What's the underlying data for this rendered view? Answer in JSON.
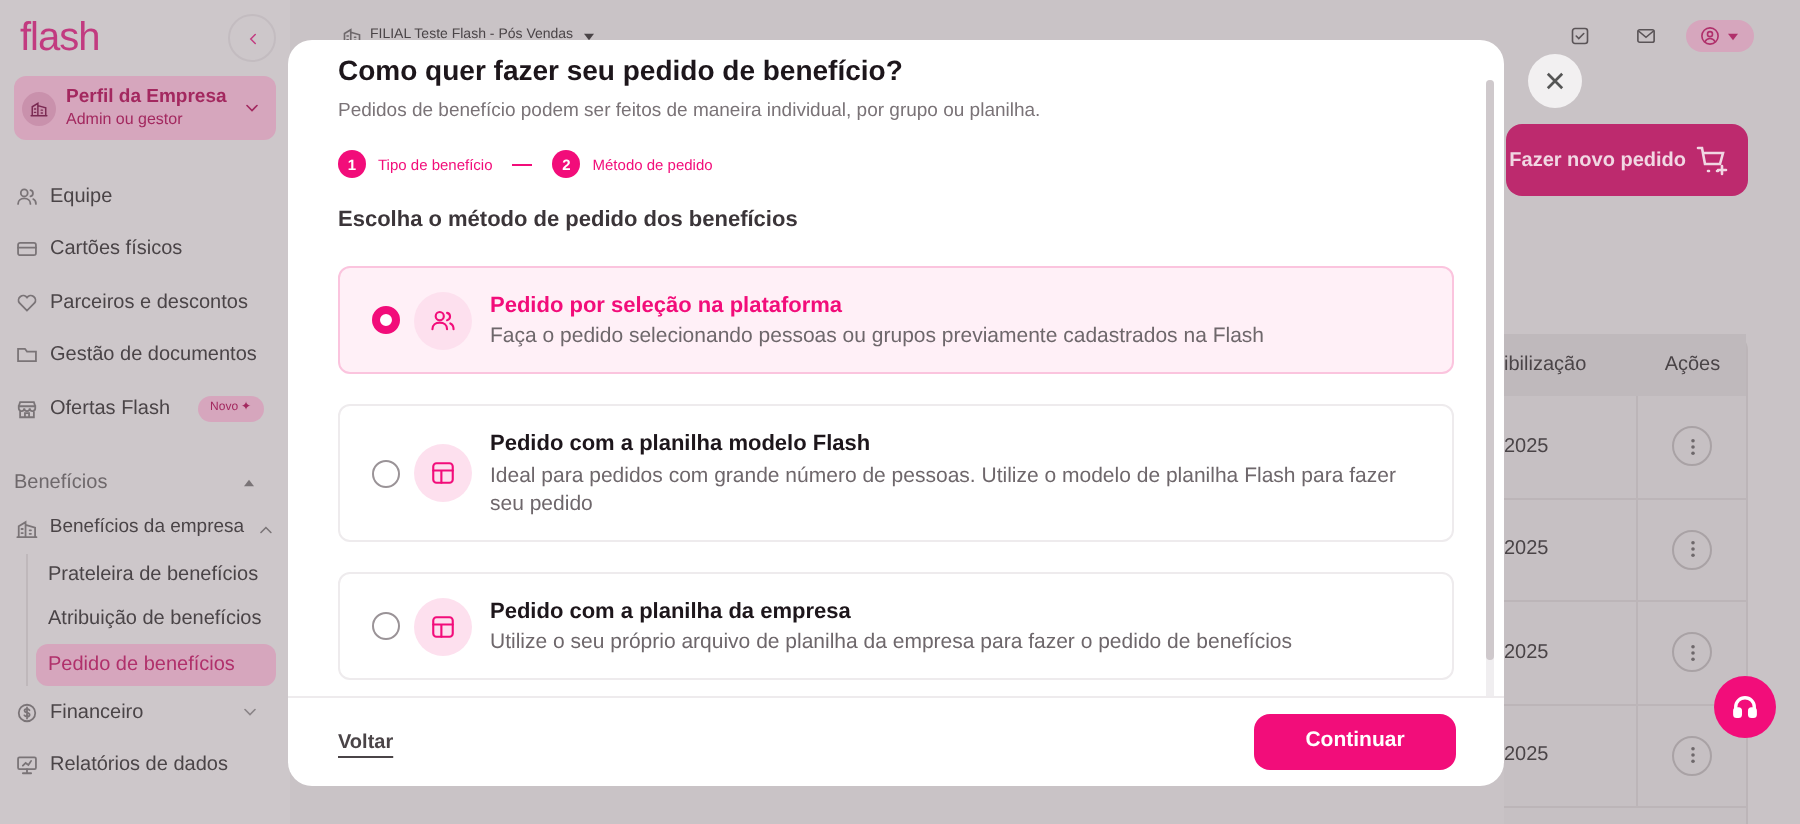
{
  "sidebar": {
    "logo": "flash",
    "profile": {
      "title": "Perfil da Empresa",
      "subtitle": "Admin ou gestor",
      "expanded": false
    },
    "items": [
      {
        "kind": "team",
        "label": "Equipe"
      },
      {
        "kind": "card",
        "label": "Cartões físicos"
      },
      {
        "kind": "partner",
        "label": "Parceiros e descontos"
      },
      {
        "kind": "folder",
        "label": "Gestão de documentos"
      },
      {
        "kind": "store",
        "label": "Ofertas Flash",
        "badge": "Novo ✦"
      }
    ],
    "section": {
      "label": "Benefícios",
      "expanded": true
    },
    "group": {
      "label": "Benefícios da empresa",
      "expanded": true,
      "children": [
        {
          "label": "Prateleira de benefícios",
          "selected": false
        },
        {
          "label": "Atribuição de benefícios",
          "selected": false
        },
        {
          "label": "Pedido de benefícios",
          "selected": true
        }
      ]
    },
    "more": [
      {
        "kind": "money",
        "label": "Financeiro",
        "expanded": false
      },
      {
        "kind": "report",
        "label": "Relatórios de dados"
      }
    ]
  },
  "topbar": {
    "company": "FILIAL Teste Flash - Pós Vendas"
  },
  "page": {
    "new_order_button": "Fazer novo pedido",
    "table": {
      "columns": [
        "ibilização",
        "Ações"
      ],
      "rows": [
        {
          "column_1": "2025"
        },
        {
          "column_1": "2025"
        },
        {
          "column_1": "2025"
        },
        {
          "column_1": "2025"
        }
      ]
    }
  },
  "modal": {
    "title": "Como quer fazer seu pedido de benefício?",
    "subtitle": "Pedidos de benefício podem ser feitos de maneira individual, por grupo ou planilha.",
    "steps": [
      {
        "number": "1",
        "label": "Tipo de benefício"
      },
      {
        "number": "2",
        "label": "Método de pedido"
      }
    ],
    "prompt": "Escolha o método de pedido dos benefícios",
    "options": [
      {
        "kind": "platform",
        "title": "Pedido por seleção na plataforma",
        "description": "Faça o pedido selecionando pessoas ou grupos previamente cadastrados na Flash",
        "selected": true
      },
      {
        "kind": "spreadsheet",
        "title": "Pedido com a planilha modelo Flash",
        "description": "Ideal para pedidos com grande número de pessoas. Utilize o modelo de planilha Flash para fazer seu pedido",
        "selected": false
      },
      {
        "kind": "spreadsheet",
        "title": "Pedido com a planilha da empresa",
        "description": "Utilize o seu próprio arquivo de planilha da empresa para fazer o pedido de benefícios",
        "selected": false
      }
    ],
    "back": "Voltar",
    "continue": "Continuar"
  }
}
